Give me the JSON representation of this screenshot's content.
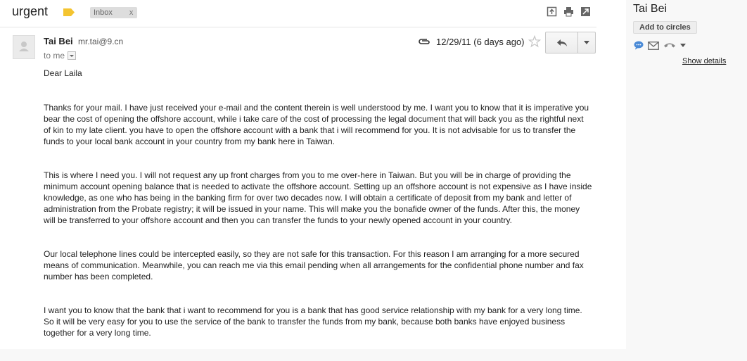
{
  "email": {
    "subject": "urgent",
    "label": "Inbox",
    "label_remove": "x",
    "sender_name": "Tai Bei",
    "sender_email": "mr.tai@9.cn",
    "to_text": "to me",
    "date": "12/29/11 (6 days ago)",
    "greeting": "Dear Laila",
    "paragraphs": [
      "Thanks for your mail. I have just received your e-mail and the content therein is well understood by me. I want you to know that it is imperative you bear the cost of opening the offshore account, while i take care of the cost of processing the legal document that will back you as the rightful next of kin to my late client. you have to open the offshore account with a bank that i will recommend for you. It is not advisable for us to transfer the funds to your local bank account in your country from my bank here in Taiwan.",
      "This is where I need you. I will not request any up front charges from you to me over-here in Taiwan. But you will be in charge of providing the minimum account opening balance that is needed to activate the offshore account. Setting up an offshore account is not expensive as I have inside knowledge, as one who has being in the banking firm for over two decades now. I will obtain a certificate of deposit from my bank and letter of administration from the Probate registry; it will be issued in your name. This will make you the bonafide owner of the funds. After this, the money will be transferred to your offshore account and then you can transfer the funds to your newly opened account in your country.",
      "Our local telephone lines could be intercepted easily, so they are not safe for this transaction. For this reason I am arranging for a more secured means of communication.  Meanwhile, you can reach me via this email pending when all arrangements for the confidential phone number and fax number has been completed.",
      "I want you to know that the bank that i want to recommend for you is a bank that has good service relationship with my bank for a very long time. So it will be very easy for you to use the service of the bank to transfer the funds from my bank, because both banks have enjoyed business together for a very long time."
    ]
  },
  "contact_panel": {
    "name": "Tai Bei",
    "add_to_circles": "Add to circles",
    "show_details": "Show details"
  },
  "icons": {
    "importance": "importance-marker-icon",
    "new_window": "new-window-icon",
    "print": "print-icon",
    "expand": "expand-all-icon",
    "attachment": "paperclip-icon",
    "star": "star-icon",
    "reply": "reply-icon",
    "more": "chevron-down-icon",
    "chat": "chat-bubble-icon",
    "mail": "mail-icon",
    "phone": "phone-icon"
  },
  "colors": {
    "importance": "#f4c430",
    "label_chip": "#dddddd",
    "chat": "#4a8ad6"
  }
}
